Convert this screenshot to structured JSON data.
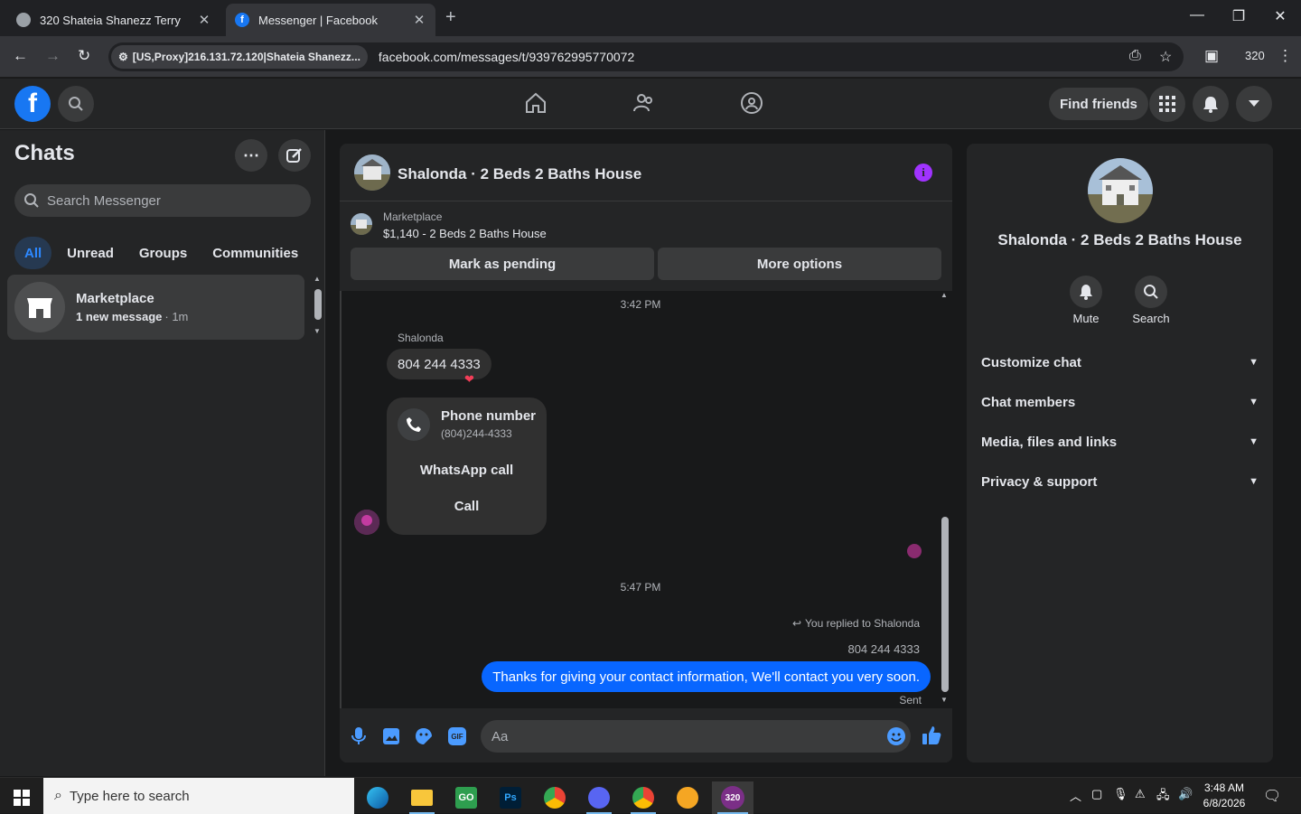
{
  "browser": {
    "tabs": [
      {
        "title": "320 Shateia Shanezz Terry"
      },
      {
        "title": "Messenger | Facebook"
      }
    ],
    "site_info": "[US,Proxy]216.131.72.120|Shateia Shanezz...",
    "url": "facebook.com/messages/t/939762995770072",
    "profile_label": "320"
  },
  "fb_nav": {
    "find_friends": "Find friends"
  },
  "sidebar": {
    "title": "Chats",
    "search_placeholder": "Search Messenger",
    "filters": [
      "All",
      "Unread",
      "Groups",
      "Communities"
    ],
    "chat": {
      "name": "Marketplace",
      "preview": "1 new message",
      "time": "· 1m"
    }
  },
  "conversation": {
    "title": "Shalonda · 2 Beds 2 Baths House",
    "marketplace_label": "Marketplace",
    "listing": "$1,140 - 2 Beds 2 Baths House",
    "mark_pending": "Mark as pending",
    "more_options": "More options",
    "messages": {
      "time1": "3:42 PM",
      "sender": "Shalonda",
      "phone_msg": "804 244 4333",
      "card_title": "Phone number",
      "card_sub": "(804)244-4333",
      "whatsapp": "WhatsApp call",
      "call": "Call",
      "time2": "5:47 PM",
      "reply_note": "You replied to Shalonda",
      "quoted": "804 244 4333",
      "outgoing": "Thanks for giving your contact information, We'll contact you very soon.",
      "status": "Sent"
    },
    "composer_placeholder": "Aa"
  },
  "details": {
    "title": "Shalonda · 2 Beds 2 Baths House",
    "mute": "Mute",
    "search": "Search",
    "sections": [
      "Customize chat",
      "Chat members",
      "Media, files and links",
      "Privacy & support"
    ]
  },
  "taskbar": {
    "search_placeholder": "Type here to search",
    "time": "3:48 AM",
    "date": "6/8/2026",
    "badge": "320"
  },
  "colors": {
    "accent": "#0866ff",
    "purple": "#a033ff",
    "fb_blue": "#1877f2"
  }
}
